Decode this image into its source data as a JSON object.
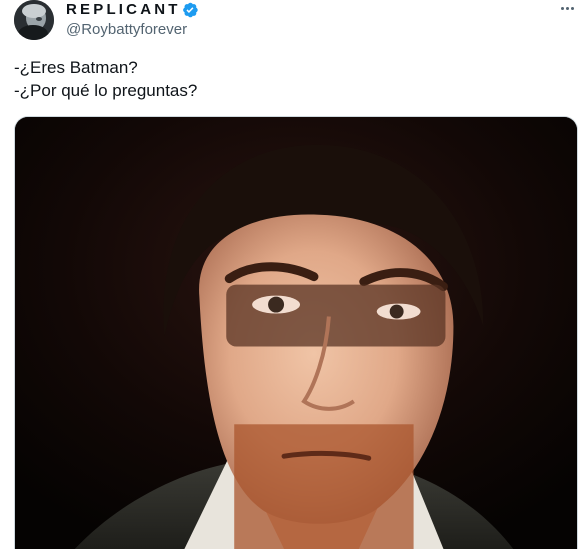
{
  "tweet": {
    "author": {
      "display_name": "REPLICANT",
      "handle": "@Roybattyforever",
      "verified": true,
      "avatar_icon": "avatar-image"
    },
    "more_icon": "more-options-icon",
    "text_lines": [
      "-¿Eres Batman?",
      "-¿Por qué lo preguntas?"
    ],
    "media": {
      "type": "photo"
    }
  },
  "colors": {
    "text_primary": "#0f1419",
    "text_secondary": "#536471",
    "verified_blue": "#1d9bf0",
    "border": "#cfd9de"
  }
}
